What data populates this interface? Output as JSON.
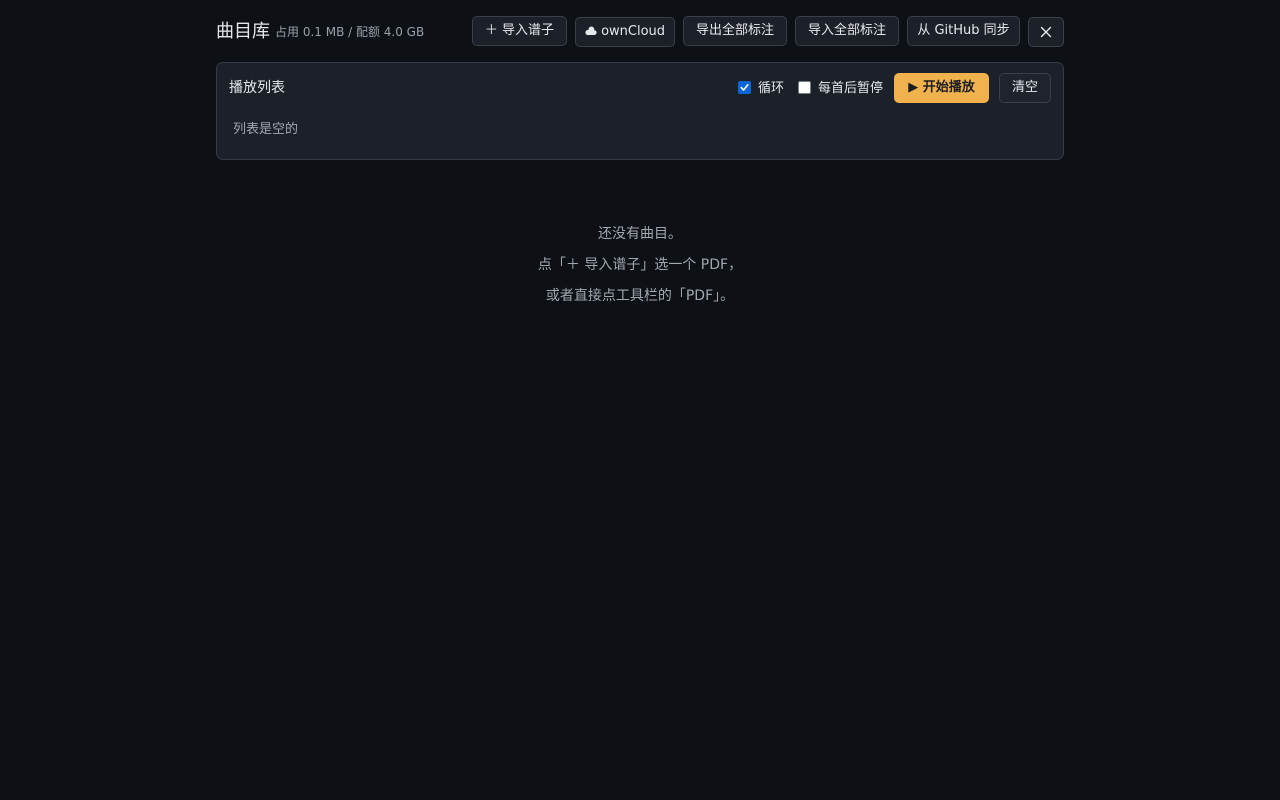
{
  "header": {
    "title": "曲目库",
    "usage": "占用 0.1 MB / 配额 4.0 GB",
    "import_score_label": "＋ 导入谱子",
    "owncloud_label": "ownCloud",
    "owncloud_icon": "cloud-icon",
    "export_all_label": "导出全部标注",
    "import_all_label": "导入全部标注",
    "github_sync_label": "从 GitHub 同步",
    "close_icon": "close-icon"
  },
  "playlist": {
    "title": "播放列表",
    "loop_label": "循环",
    "loop_checked": true,
    "pause_label": "每首后暂停",
    "pause_checked": false,
    "play_label": "▶ 开始播放",
    "clear_label": "清空",
    "empty_text": "列表是空的"
  },
  "empty_state": {
    "line1": "还没有曲目。",
    "line2": "点「＋ 导入谱子」选一个 PDF，",
    "line3": "或者直接点工具栏的「PDF」。"
  },
  "colors": {
    "background": "#0d1015",
    "panel": "#1b2029",
    "accent": "#f0b24d",
    "checkbox": "#0a66d6"
  }
}
